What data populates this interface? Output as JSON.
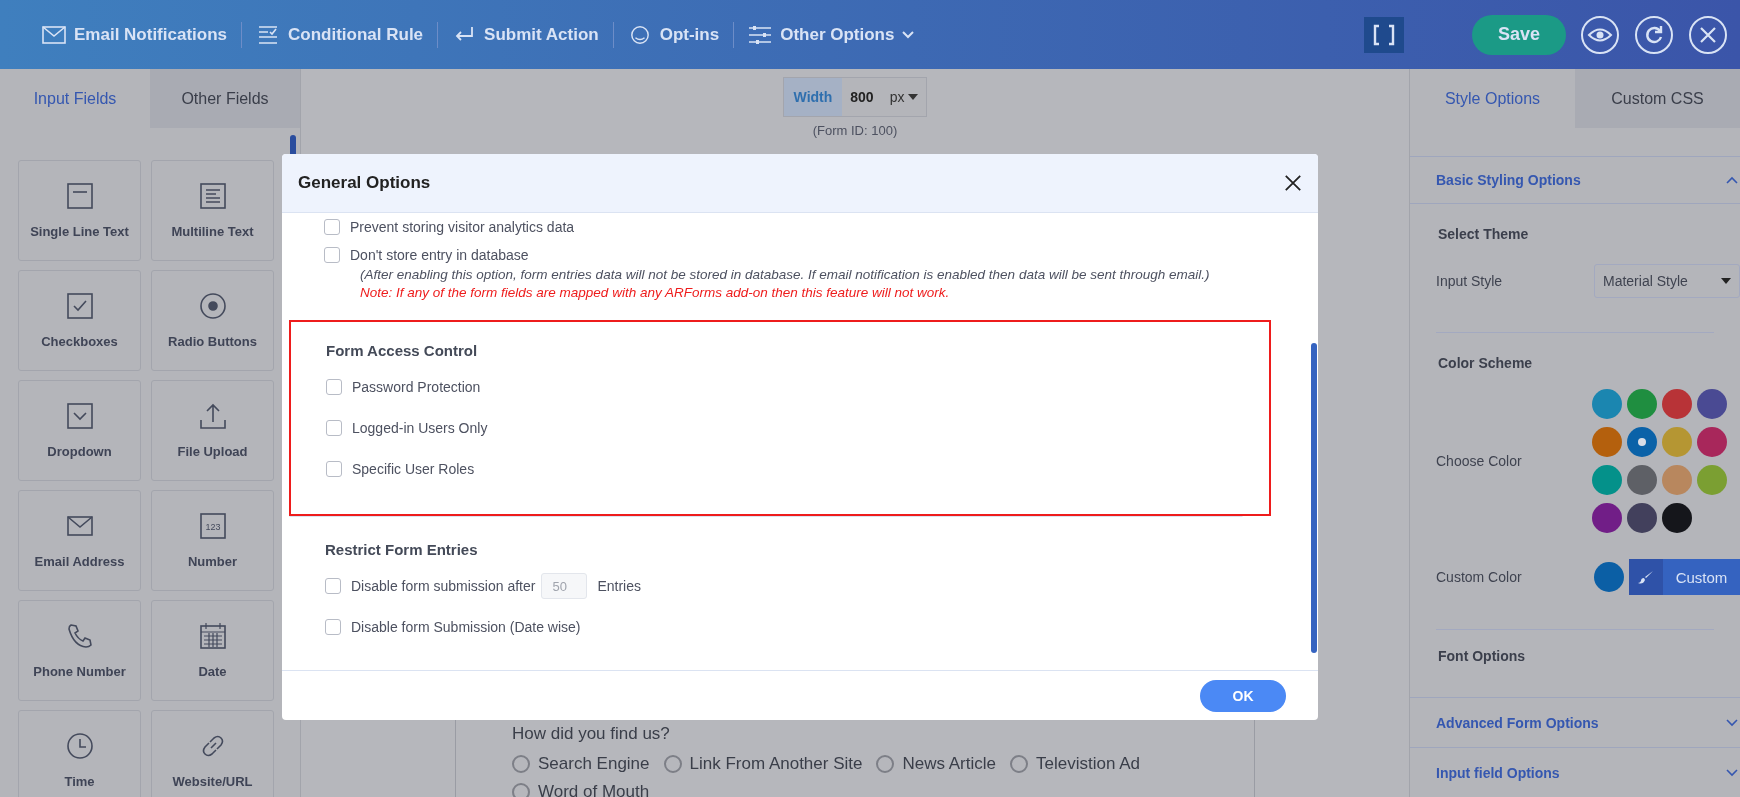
{
  "toolbar": {
    "items": [
      {
        "label": "Email Notifications",
        "kind": "email"
      },
      {
        "label": "Conditional Rule",
        "kind": "rule"
      },
      {
        "label": "Submit Action",
        "kind": "submit"
      },
      {
        "label": "Opt-ins",
        "kind": "optin"
      },
      {
        "label": "Other Options",
        "kind": "options",
        "dropdown": true
      }
    ],
    "save": "Save"
  },
  "left_panel": {
    "tabs": [
      {
        "label": "Input Fields",
        "selected": true
      },
      {
        "label": "Other Fields",
        "selected": false
      }
    ],
    "fields": [
      {
        "label": "Single Line Text",
        "kind": "line"
      },
      {
        "label": "Multiline Text",
        "kind": "multiline"
      },
      {
        "label": "Checkboxes",
        "kind": "checkbox"
      },
      {
        "label": "Radio Buttons",
        "kind": "radio"
      },
      {
        "label": "Dropdown",
        "kind": "dropdown"
      },
      {
        "label": "File Upload",
        "kind": "upload"
      },
      {
        "label": "Email Address",
        "kind": "email"
      },
      {
        "label": "Number",
        "kind": "number"
      },
      {
        "label": "Phone Number",
        "kind": "phone"
      },
      {
        "label": "Date",
        "kind": "date"
      },
      {
        "label": "Time",
        "kind": "time"
      },
      {
        "label": "Website/URL",
        "kind": "link"
      }
    ],
    "number_icon_text": "123"
  },
  "canvas": {
    "width_label": "Width",
    "width_value": "800",
    "unit": "px",
    "form_id": "(Form ID: 100)",
    "question": "How did you find us?",
    "options": [
      {
        "label": "Search Engine",
        "checked": false
      },
      {
        "label": "Link From Another Site",
        "checked": false
      },
      {
        "label": "News Article",
        "checked": false
      },
      {
        "label": "Televistion Ad",
        "checked": false
      },
      {
        "label": "Word of Mouth",
        "checked": false
      }
    ]
  },
  "modal": {
    "title": "General Options",
    "options": [
      {
        "label": "Prevent storing visitor analytics data",
        "checked": false
      },
      {
        "label": "Don't store entry in database",
        "checked": false,
        "note": "(After enabling this option, form entries data will not be stored in database. If email notification is enabled then data will be sent through email.)",
        "warning": "Note: If any of the form fields are mapped with any ARForms add-on then this feature will not work."
      }
    ],
    "sections": [
      {
        "title": "Form Access Control",
        "highlighted": true,
        "options": [
          {
            "label": "Password Protection",
            "checked": false
          },
          {
            "label": "Logged-in Users Only",
            "checked": false
          },
          {
            "label": "Specific User Roles",
            "checked": false
          }
        ]
      },
      {
        "title": "Restrict Form Entries",
        "highlighted": false,
        "options": [
          {
            "label": "Disable form submission after",
            "checked": false,
            "placeholder": "50",
            "suffix": "Entries"
          },
          {
            "label": "Disable form Submission (Date wise)",
            "checked": false
          }
        ]
      }
    ],
    "ok": "OK"
  },
  "right_panel": {
    "tabs": [
      {
        "label": "Style Options",
        "selected": true
      },
      {
        "label": "Custom CSS",
        "selected": false
      }
    ],
    "basic": {
      "title": "Basic Styling Options",
      "expanded": true,
      "select_theme": "Select Theme",
      "input_style_label": "Input Style",
      "input_style_value": "Material Style",
      "color_scheme": "Color Scheme",
      "choose_color": "Choose Color",
      "colors": [
        {
          "color": "#1b86b0",
          "selected": false
        },
        {
          "color": "#1f8e40",
          "selected": false
        },
        {
          "color": "#b83337",
          "selected": false
        },
        {
          "color": "#4a4a93",
          "selected": false
        },
        {
          "color": "#b4600d",
          "selected": false
        },
        {
          "color": "#0b62a8",
          "selected": true
        },
        {
          "color": "#b59633",
          "selected": false
        },
        {
          "color": "#a8275b",
          "selected": false
        },
        {
          "color": "#04918a",
          "selected": false
        },
        {
          "color": "#5e6066",
          "selected": false
        },
        {
          "color": "#b8875e",
          "selected": false
        },
        {
          "color": "#7b9f32",
          "selected": false
        },
        {
          "color": "#711e87",
          "selected": false
        },
        {
          "color": "#42405c",
          "selected": false
        },
        {
          "color": "#15161b",
          "selected": false
        }
      ],
      "custom_color_label": "Custom Color",
      "custom_swatch": {
        "color": "#0b5fa5"
      },
      "custom_button": "Custom",
      "font_options": "Font Options"
    },
    "collapsed": [
      {
        "title": "Advanced Form Options",
        "expanded": false
      },
      {
        "title": "Input field Options",
        "expanded": false
      }
    ]
  }
}
